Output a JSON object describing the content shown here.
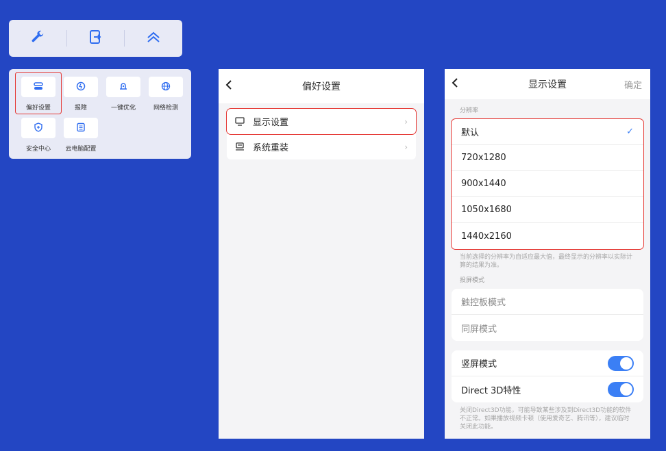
{
  "colors": {
    "background": "#2346c3",
    "panel": "#e8eaf6",
    "accent": "#3b7ff5",
    "highlight": "#e53935"
  },
  "toolbar": {
    "icons": [
      "wrench-icon",
      "exit-icon",
      "collapse-up-icon"
    ]
  },
  "tools": {
    "items": [
      {
        "label": "偏好设置",
        "icon": "preferences-icon"
      },
      {
        "label": "报障",
        "icon": "report-fault-icon"
      },
      {
        "label": "一键优化",
        "icon": "optimize-icon"
      },
      {
        "label": "网络检测",
        "icon": "network-check-icon"
      },
      {
        "label": "安全中心",
        "icon": "security-center-icon"
      },
      {
        "label": "云电脑配置",
        "icon": "cloud-pc-config-icon"
      }
    ]
  },
  "preferences": {
    "title": "偏好设置",
    "items": [
      {
        "label": "显示设置",
        "icon": "monitor-icon"
      },
      {
        "label": "系统重装",
        "icon": "system-reinstall-icon"
      }
    ]
  },
  "display_settings": {
    "title": "显示设置",
    "confirm_label": "确定",
    "resolution_label": "分辨率",
    "resolutions": [
      "默认",
      "720x1280",
      "900x1440",
      "1050x1680",
      "1440x2160"
    ],
    "selected_resolution": "默认",
    "resolution_note": "当前选择的分辨率为自适应最大值，最终显示的分辨率以实际计算的结果为准。",
    "projection_label": "投屏模式",
    "projection_modes": [
      "触控板模式",
      "同屏模式"
    ],
    "toggles": [
      {
        "label": "竖屏模式",
        "on": true
      },
      {
        "label": "Direct 3D特性",
        "on": true
      }
    ],
    "direct3d_note": "关闭Direct3D功能，可能导致某些涉及到Direct3D功能的软件不正常。如果播放视频卡顿（使用爱奇艺、腾讯等），建议临时关闭此功能。"
  }
}
